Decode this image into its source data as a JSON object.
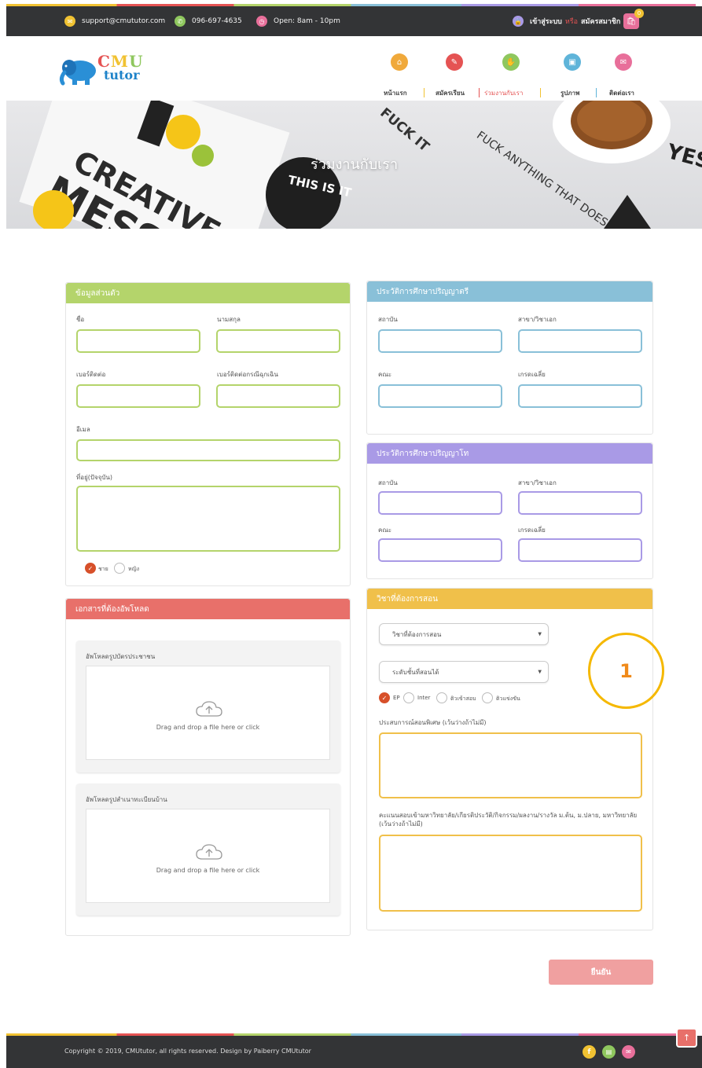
{
  "topbar": {
    "email": "support@cmututor.com",
    "phone": "096-697-4635",
    "hours": "Open: 8am - 10pm",
    "login": "เข้าสู่ระบบ",
    "or": "หรือ",
    "register": "สมัครสมาชิก",
    "cart_count": "0"
  },
  "logo": {
    "cmu": "CMU",
    "tutor": "tutor"
  },
  "nav": [
    {
      "label": "หน้าแรก",
      "icon": "home-icon",
      "color": "#f0a93b"
    },
    {
      "label": "สมัครเรียน",
      "icon": "pencil-icon",
      "color": "#e55353"
    },
    {
      "label": "ร่วมงานกับเรา",
      "icon": "handshake-icon",
      "color": "#8fc75e"
    },
    {
      "label": "รูปภาพ",
      "icon": "image-icon",
      "color": "#5fb4d9"
    },
    {
      "label": "ติดต่อเรา",
      "icon": "mail-icon",
      "color": "#e86f9a"
    }
  ],
  "hero": {
    "title": "ร่วมงานกับเรา",
    "art_words": {
      "a": "CREATIVE",
      "b": "MESS",
      "c": "THIS IS IT",
      "d": "FUCK IT",
      "e": "FUCK ANYTHING THAT DOESN'T MAKE YOU HAPPY",
      "f": "YES"
    }
  },
  "personal": {
    "title": "ข้อมูลส่วนตัว",
    "first_name": "ชื่อ",
    "last_name": "นามสกุล",
    "phone": "เบอร์ติดต่อ",
    "emergency_phone": "เบอร์ติดต่อกรณีฉุกเฉิน",
    "email": "อีเมล",
    "address": "ที่อยู่(ปัจจุบัน)",
    "male": "ชาย",
    "female": "หญิง"
  },
  "bachelor": {
    "title": "ประวัติการศึกษาปริญญาตรี",
    "institution": "สถาบัน",
    "major": "สาขา/วิชาเอก",
    "faculty": "คณะ",
    "gpa": "เกรดเฉลี่ย"
  },
  "master": {
    "title": "ประวัติการศึกษาปริญญาโท",
    "institution": "สถาบัน",
    "major": "สาขา/วิชาเอก",
    "faculty": "คณะ",
    "gpa": "เกรดเฉลี่ย"
  },
  "teach": {
    "title": "วิชาที่ต้องการสอน",
    "subject_select": "วิชาที่ต้องการสอน",
    "level_select": "ระดับชั้นที่สอนได้",
    "options": [
      "EP",
      "Inter",
      "ติวเข้าสอบ",
      "ติวแข่งขัน"
    ],
    "experience": "ประสบการณ์สอนพิเศษ (เว้นว่างถ้าไม่มี)",
    "scores": "คะแนนสอบเข้ามหาวิทยาลัย/เกียรติประวัติ/กิจกรรม/ผลงาน/รางวัล ม.ต้น, ม.ปลาย, มหาวิทยาลัย (เว้นว่างถ้าไม่มี)",
    "annotation": "1"
  },
  "docs": {
    "title": "เอกสารที่ต้องอัพโหลด",
    "id_card": "อัพโหลดรูปบัตรประชาชน",
    "house_reg": "อัพโหลดรูปสำเนาทะเบียนบ้าน",
    "dropzone": "Drag and drop a file here or click"
  },
  "submit": "ยืนยัน",
  "footer": {
    "copyright": "Copyright © 2019, CMUtutor, all rights reserved. Design by Paiberry CMUtutor"
  },
  "colors": {
    "green": "#b4d46b",
    "blue": "#89c0d8",
    "purple": "#a99ae6",
    "yellow": "#f0c04a",
    "red": "#e8706a",
    "submit": "#f0a0a0"
  }
}
